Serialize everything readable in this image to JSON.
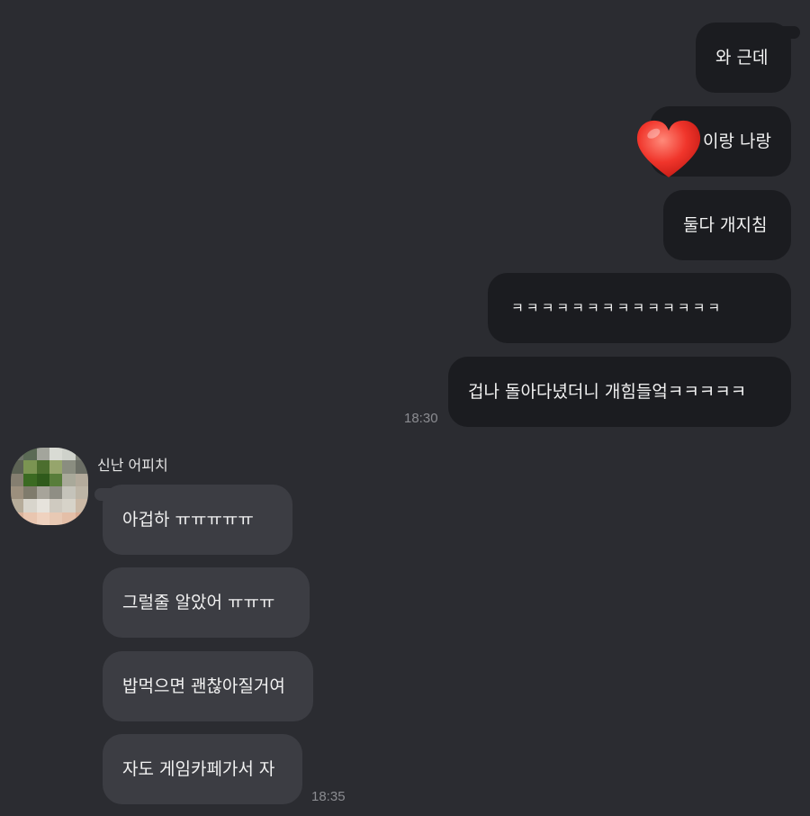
{
  "chat": {
    "sent_messages": [
      {
        "text": "와 근데"
      },
      {
        "text": "이랑 나랑"
      },
      {
        "text": "둘다 개지침"
      },
      {
        "text": "ㅋㅋㅋㅋㅋㅋㅋㅋㅋㅋㅋㅋㅋㅋ"
      },
      {
        "text": "겁나 돌아다녔더니 개힘들엌ㅋㅋㅋㅋㅋ"
      }
    ],
    "sent_time": "18:30",
    "received": {
      "sender_name": "신난 어피치",
      "messages": [
        {
          "text": "아겁하 ㅠㅠㅠㅠㅠ"
        },
        {
          "text": "그럴줄 알았어 ㅠㅠㅠ"
        },
        {
          "text": "밥먹으면 괜찮아질거여"
        },
        {
          "text": "자도 게임카페가서 자"
        }
      ],
      "time": "18:35"
    },
    "sticker": "heart-emoji",
    "colors": {
      "background": "#2b2c31",
      "sent_bubble": "#1b1c20",
      "received_bubble": "#3c3d43",
      "text": "#f2f2f2",
      "timestamp": "#8b8c91"
    }
  }
}
